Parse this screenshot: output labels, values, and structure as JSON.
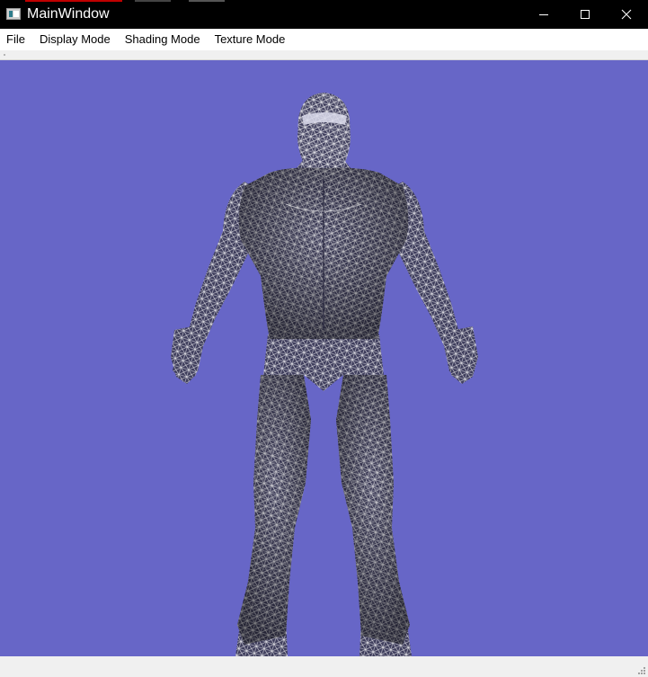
{
  "window": {
    "title": "MainWindow",
    "controls": [
      "minimize-icon",
      "maximize-icon",
      "close-icon"
    ]
  },
  "menubar": {
    "items": [
      {
        "label": "File"
      },
      {
        "label": "Display Mode"
      },
      {
        "label": "Shading Mode"
      },
      {
        "label": "Texture Mode"
      }
    ]
  },
  "viewport": {
    "background_color": "#6766c7",
    "render_mode": "wireframe",
    "model": "humanoid-armored-character",
    "mesh_color": "#ffffff"
  },
  "colors": {
    "titlebar": "#000000",
    "menubar": "#ffffff",
    "chrome": "#f0f0f0"
  }
}
